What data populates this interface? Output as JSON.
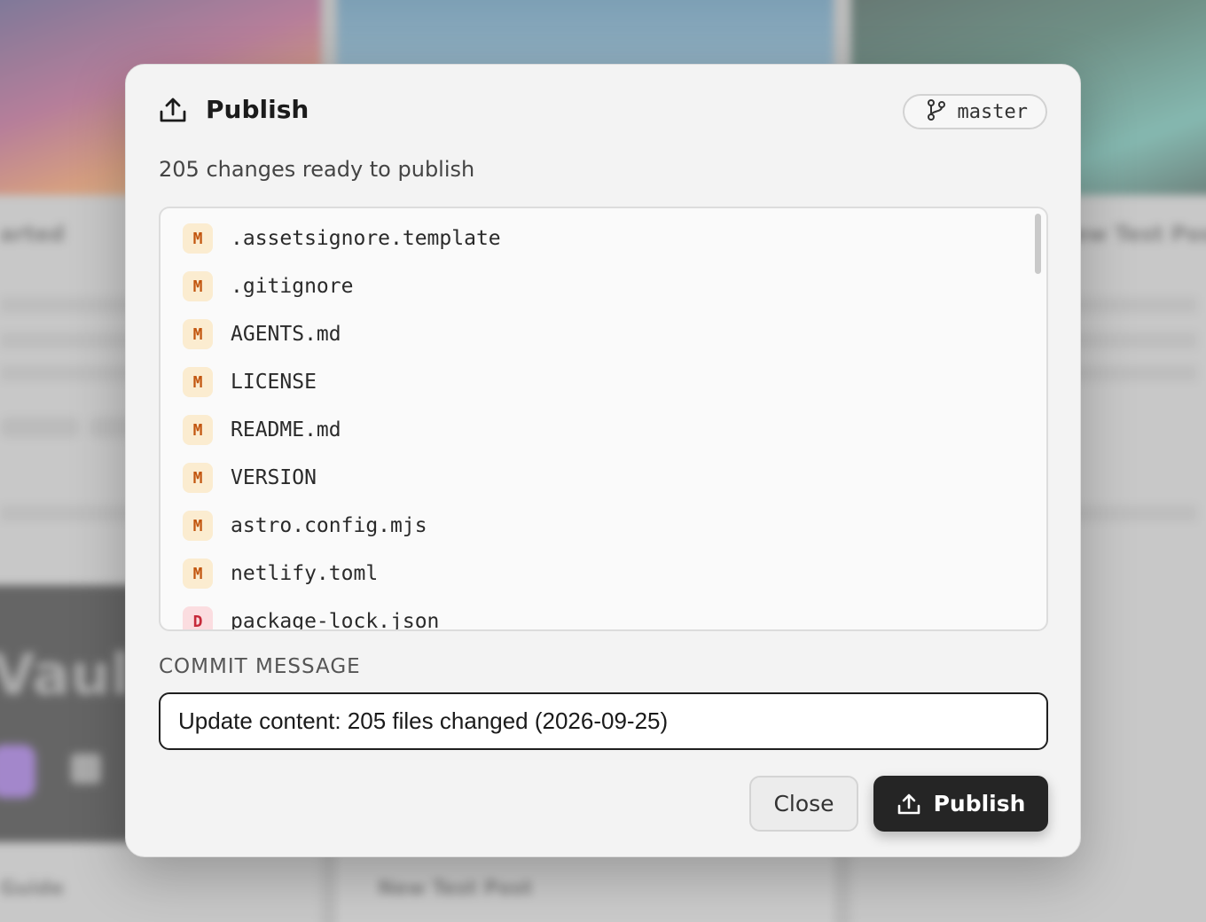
{
  "background": {
    "texts": [
      "arted",
      "New Test Post",
      "Guide",
      "New Test Post",
      "Vaul"
    ]
  },
  "dialog": {
    "title": "Publish",
    "branch": "master",
    "subtitle": "205 changes ready to publish",
    "files": [
      {
        "status": "M",
        "name": ".assetsignore.template"
      },
      {
        "status": "M",
        "name": ".gitignore"
      },
      {
        "status": "M",
        "name": "AGENTS.md"
      },
      {
        "status": "M",
        "name": "LICENSE"
      },
      {
        "status": "M",
        "name": "README.md"
      },
      {
        "status": "M",
        "name": "VERSION"
      },
      {
        "status": "M",
        "name": "astro.config.mjs"
      },
      {
        "status": "M",
        "name": "netlify.toml"
      },
      {
        "status": "D",
        "name": "package-lock.json"
      }
    ],
    "commit_label": "COMMIT MESSAGE",
    "commit_message": "Update content: 205 files changed (2026-09-25)",
    "close_label": "Close",
    "publish_label": "Publish"
  },
  "colors": {
    "modified_badge_bg": "#fbecd0",
    "modified_badge_fg": "#c2560f",
    "deleted_badge_bg": "#fbdde0",
    "deleted_badge_fg": "#c62a3a",
    "primary_button": "#252525"
  },
  "icons": {
    "header": "upload-icon",
    "branch": "git-branch-icon",
    "publish_button": "upload-icon"
  }
}
